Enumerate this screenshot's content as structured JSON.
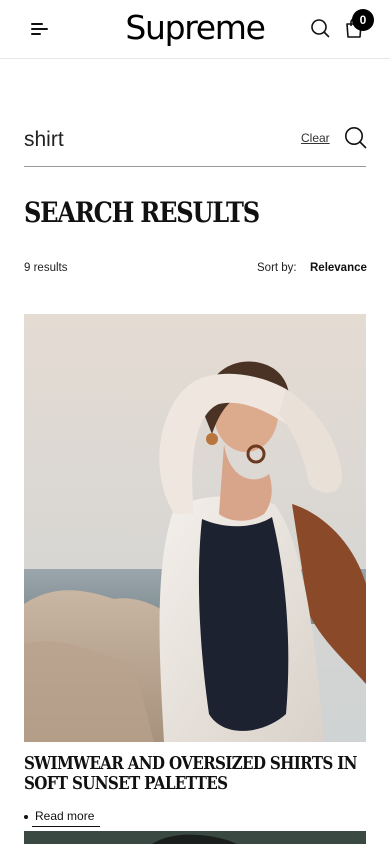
{
  "header": {
    "logo": "Supreme",
    "cart_count": "0",
    "menu_icon": "menu-icon",
    "search_icon": "search-icon",
    "cart_icon": "shopping-bag-icon"
  },
  "search": {
    "query": "shirt",
    "clear_label": "Clear",
    "submit_icon": "search-icon"
  },
  "results": {
    "title": "SEARCH RESULTS",
    "count": "9 results",
    "sort_label": "Sort by:",
    "sort_value": "Relevance"
  },
  "articles": [
    {
      "title": "SWIMWEAR AND OVERSIZED SHIRTS IN SOFT SUNSET PALETTES",
      "cta": "Read more"
    }
  ],
  "colors": {
    "text": "#111111",
    "divider": "#e6e6e6",
    "badge": "#000000"
  }
}
